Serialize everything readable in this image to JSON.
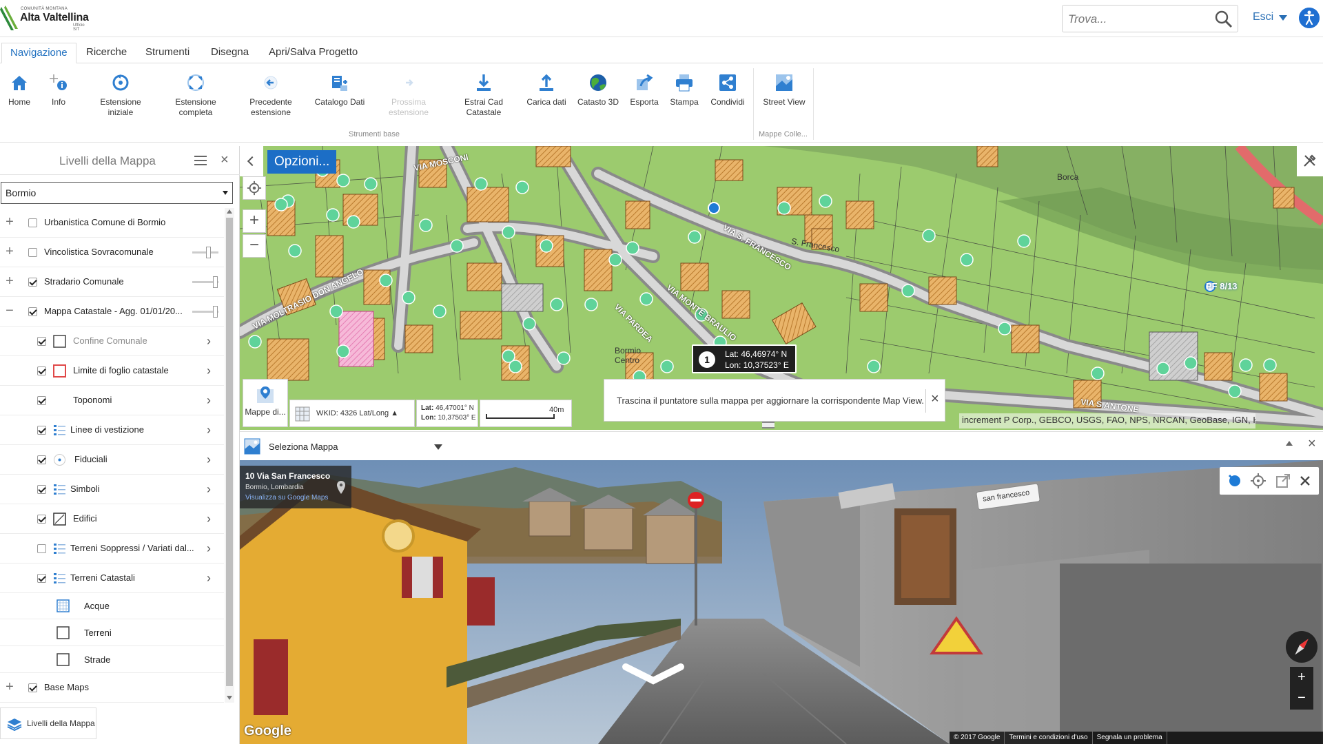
{
  "header": {
    "logo_small": "COMUNITÀ MONTANA",
    "logo_big": "Alta Valtellina",
    "logo_sub": "Ufficio SIT",
    "search_placeholder": "Trova...",
    "user_menu": "Esci"
  },
  "tabs": [
    {
      "label": "Navigazione",
      "active": true
    },
    {
      "label": "Ricerche"
    },
    {
      "label": "Strumenti"
    },
    {
      "label": "Disegna"
    },
    {
      "label": "Apri/Salva Progetto"
    }
  ],
  "ribbon": {
    "buttons": [
      {
        "label": "Home",
        "icon": "home-icon"
      },
      {
        "label": "Info",
        "icon": "info-icon"
      },
      {
        "label": "Estensione iniziale",
        "icon": "initial-extent-icon"
      },
      {
        "label": "Estensione completa",
        "icon": "full-extent-icon"
      },
      {
        "label": "Precedente estensione",
        "icon": "previous-extent-icon"
      },
      {
        "label": "Catalogo Dati",
        "icon": "data-catalog-icon"
      },
      {
        "label": "Prossima estensione",
        "icon": "next-extent-icon",
        "disabled": true
      },
      {
        "label": "Estrai Cad Catastale",
        "icon": "download-icon"
      },
      {
        "label": "Carica dati",
        "icon": "upload-icon"
      },
      {
        "label": "Catasto 3D",
        "icon": "globe-icon"
      },
      {
        "label": "Esporta",
        "icon": "export-icon"
      },
      {
        "label": "Stampa",
        "icon": "print-icon"
      },
      {
        "label": "Condividi",
        "icon": "share-icon"
      },
      {
        "label": "Street View",
        "icon": "street-view-icon"
      }
    ],
    "group_base": "Strumenti base",
    "group_maps": "Mappe Colle..."
  },
  "layers_panel": {
    "title": "Livelli della Mappa",
    "comune": "Bormio",
    "items": [
      {
        "label": "Urbanistica Comune di Bormio",
        "checked": false,
        "expand": "+",
        "bold": true
      },
      {
        "label": "Vincolistica Sovracomunale",
        "checked": false,
        "expand": "+",
        "bold": true,
        "slider": 0.6
      },
      {
        "label": "Stradario Comunale",
        "checked": true,
        "expand": "+",
        "bold": true,
        "slider": 0.9
      },
      {
        "label": "Mappa Catastale - Agg. 01/01/20...",
        "checked": true,
        "expand": "−",
        "bold": true,
        "slider": 0.9
      },
      {
        "label": "Confine Comunale",
        "checked": true,
        "symbol": "square-outline-icon",
        "gray": true
      },
      {
        "label": "Limite di foglio catastale",
        "checked": true,
        "symbol": "red-square-icon"
      },
      {
        "label": "Toponomi",
        "checked": true
      },
      {
        "label": "Linee di vestizione",
        "checked": true,
        "symbol": "legend-list-icon"
      },
      {
        "label": "Fiduciali",
        "checked": true,
        "symbol": "dot-circle-icon"
      },
      {
        "label": "Simboli",
        "checked": true,
        "symbol": "legend-list-icon"
      },
      {
        "label": "Edifici",
        "checked": true,
        "symbol": "hatched-square-icon"
      },
      {
        "label": "Terreni Soppressi / Variati dal...",
        "checked": false,
        "symbol": "legend-list-icon"
      },
      {
        "label": "Terreni Catastali",
        "checked": true,
        "symbol": "legend-list-icon"
      }
    ],
    "sub_items": [
      {
        "label": "Acque",
        "symbol": "blue-grid-square-icon"
      },
      {
        "label": "Terreni",
        "symbol": "square-outline-icon"
      },
      {
        "label": "Strade",
        "symbol": "square-outline-icon"
      }
    ],
    "base_maps": {
      "label": "Base Maps",
      "checked": true,
      "expand": "+"
    },
    "footer_tab": "Livelli della Mappa"
  },
  "map": {
    "options_button": "Opzioni...",
    "marker_number": "1",
    "marker_lat": "Lat: 46,46974° N",
    "marker_lon": "Lon: 10,37523° E",
    "basemap_button": "Mappe di...",
    "wkid": "WKID: 4326 Lat/Long ▲",
    "cursor_lat_label": "Lat:",
    "cursor_lat": "46,47001° N",
    "cursor_lon_label": "Lon:",
    "cursor_lon": "10,37503° E",
    "scale_label": "40m",
    "drag_message": "Trascina il puntatore sulla mappa per aggiornare la corrispondente Map View.",
    "attribution": "increment P Corp., GEBCO, USGS, FAO, NPS, NRCAN, GeoBase, IGN, Kadaster NL, ...",
    "labels": [
      "VIA MOSCONI",
      "VIA MOLTRASIO DON ANGELO",
      "VIA MONTE BRAULIO",
      "VIA S. FRANCESCO",
      "VIA PARDEA",
      "Bormio Centro",
      "S. Francesco",
      "PF 8/13",
      "Borca",
      "VIA S.ANTONE"
    ]
  },
  "street_view": {
    "select_label": "Seleziona Mappa",
    "address": "10 Via San Francesco",
    "locality": "Bormio, Lombardia",
    "gmaps_link": "Visualizza su Google Maps",
    "sign_text": "san francesco",
    "google": "Google",
    "legal": [
      "© 2017 Google",
      "Termini e condizioni d'uso",
      "Segnala un problema"
    ]
  }
}
